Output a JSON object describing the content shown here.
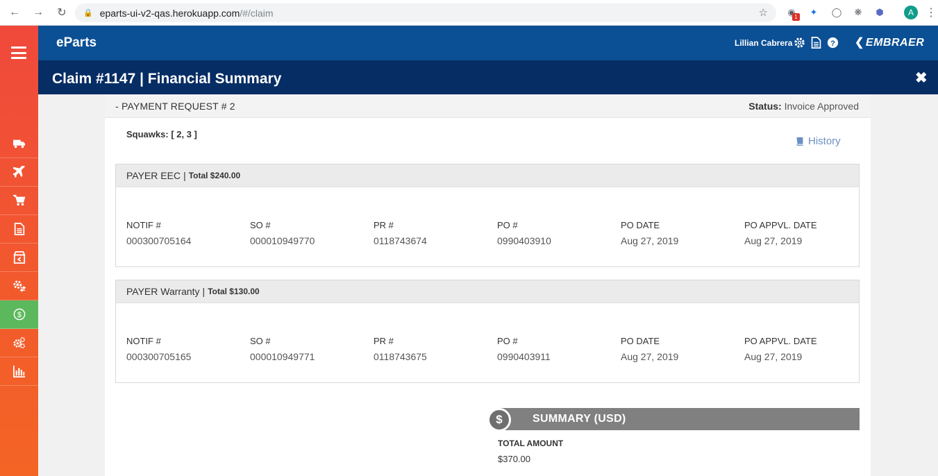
{
  "browser": {
    "url_host": "eparts-ui-v2-qas.herokuapp.com",
    "url_path": "/#/claim",
    "extension_badge": "1",
    "profile_initial": "A"
  },
  "app": {
    "title": "eParts",
    "user_name": "Lillian Cabrera",
    "brand": "EMBRAER"
  },
  "page": {
    "title": "Claim #1147 | Financial Summary"
  },
  "payment_request": {
    "title": "- PAYMENT REQUEST # 2",
    "status_label": "Status:",
    "status_value": "Invoice Approved",
    "squawks_label": "Squawks:",
    "squawks_value": "[ 2, 3 ]",
    "history_label": "History"
  },
  "column_labels": {
    "notif": "NOTIF #",
    "so": "SO #",
    "pr": "PR #",
    "po": "PO #",
    "po_date": "PO DATE",
    "po_appvl_date": "PO APPVL. DATE"
  },
  "payers": [
    {
      "name": "PAYER EEC",
      "separator": "|",
      "total": "Total $240.00",
      "notif": "000300705164",
      "so": "000010949770",
      "pr": "0118743674",
      "po": "0990403910",
      "po_date": "Aug 27, 2019",
      "po_appvl_date": "Aug 27, 2019"
    },
    {
      "name": "PAYER Warranty",
      "separator": "|",
      "total": "Total $130.00",
      "notif": "000300705165",
      "so": "000010949771",
      "pr": "0118743675",
      "po": "0990403911",
      "po_date": "Aug 27, 2019",
      "po_appvl_date": "Aug 27, 2019"
    }
  ],
  "summary": {
    "title": "SUMMARY (USD)",
    "coin_symbol": "$",
    "total_label": "TOTAL AMOUNT",
    "total_value": "$370.00"
  },
  "colors": {
    "sidebar": "#f0493c",
    "sidebar_active": "#5cb85c",
    "header": "#0b4f94",
    "title_bar": "#062d64",
    "history_link": "#6b8fc4",
    "summary_bar": "#808080"
  }
}
